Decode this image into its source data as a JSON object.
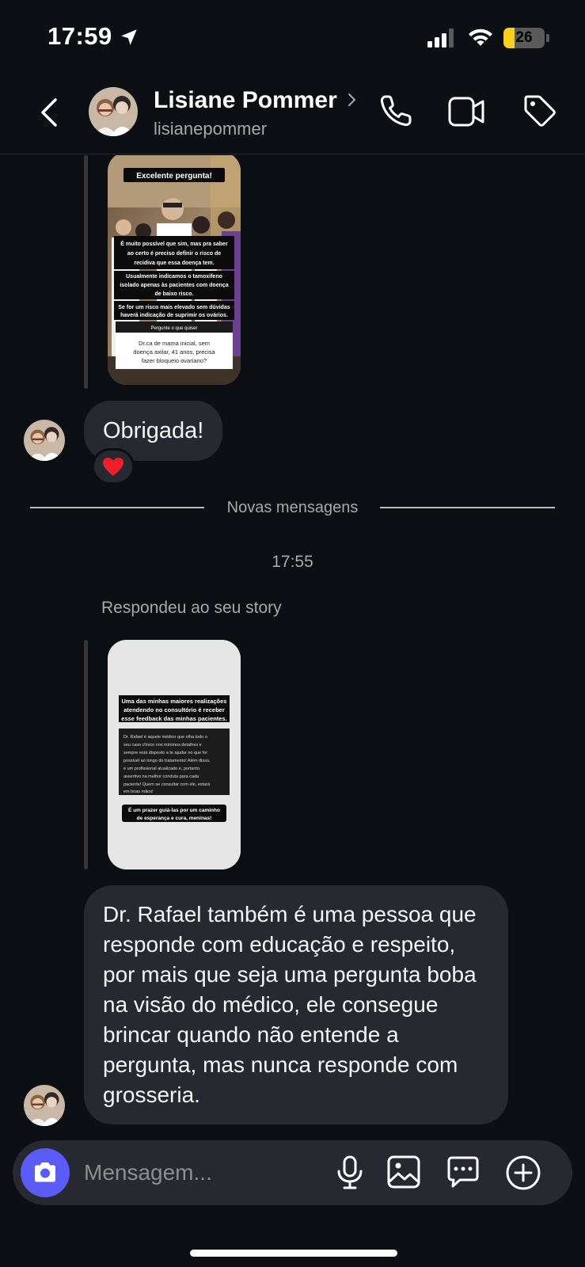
{
  "status_bar": {
    "time": "17:59",
    "battery": "26",
    "battery_level": 0.26
  },
  "header": {
    "name": "Lisiane Pommer",
    "username": "lisianepommer"
  },
  "messages": {
    "story1": {
      "banner": "Excelente pergunta!",
      "p1": "É muito possível que sim, mas pra saber",
      "p1b": "ao certo é preciso definir o risco de",
      "p1c": "recidiva que essa doença tem.",
      "p2": "Usualmente indicamos o tamoxifeno",
      "p2b": "isolado apenas às pacientes com doença",
      "p2c": "de baixo risco.",
      "p3": "Se for um risco mais elevado sem dúvidas",
      "p3b": "haverá indicação de suprimir os ovários.",
      "question_header": "Pergunte o que quiser",
      "question_l1": "Dr.ca de mama inicial, sem",
      "question_l2": "doença axilar, 41 anos, precisa",
      "question_l3": "fazer bloqueio ovariano?"
    },
    "thanks": "Obrigada!",
    "reaction": "❤️",
    "divider": "Novas mensagens",
    "timestamp": "17:55",
    "replied_label": "Respondeu ao seu story",
    "story2": {
      "title_l1": "Uma das minhas maiores realizações",
      "title_l2": "atendendo no consultório é receber",
      "title_l3": "esse feedback das minhas pacientes.",
      "quote_l1": "Dr. Rafael é aquele médico que olha todo o",
      "quote_l2": "seu caso clínico nos mínimos detalhes e",
      "quote_l3": "sempre está disposto a te ajudar no que for",
      "quote_l4": "possível ao longo do tratamento! Além disso,",
      "quote_l5": "é um profissional atualizado e, portanto,",
      "quote_l6": "assertivo na melhor conduta para cada",
      "quote_l7": "paciente! Quem se consultar com ele, estará",
      "quote_l8": "em boas mãos!",
      "footer_l1": "É um prazer guiá-las por um caminho",
      "footer_l2": "de esperança e cura, meninas!"
    },
    "long_message": "Dr. Rafael também é uma pessoa que responde com educação e respeito, por mais que seja uma pergunta boba na visão do médico, ele consegue brincar quando não entende a pergunta, mas nunca responde com grosseria."
  },
  "composer": {
    "placeholder": "Mensagem..."
  },
  "colors": {
    "background": "#0c1014",
    "bubble": "#262a30",
    "camera_button": "#5b5bf6",
    "battery_fill": "#f7d21b"
  }
}
